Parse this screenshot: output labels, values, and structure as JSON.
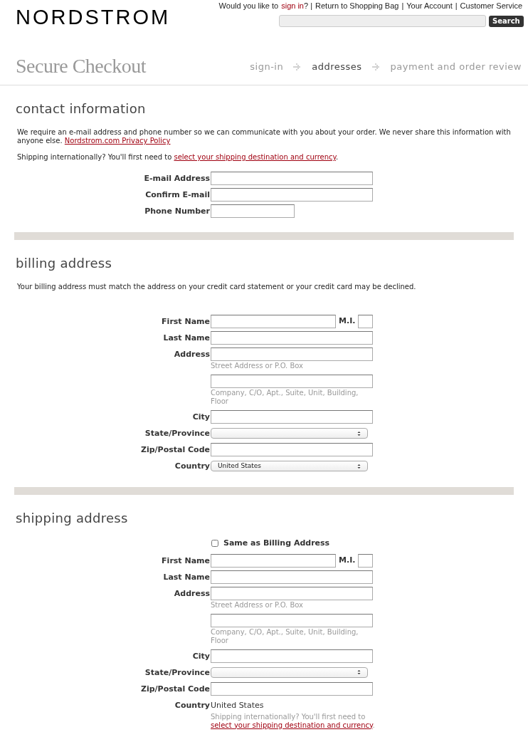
{
  "top_links": [
    {
      "kind": "text",
      "text": "Would you like to"
    },
    {
      "kind": "link",
      "text": "sign in"
    },
    {
      "kind": "text",
      "text": "? |"
    },
    {
      "kind": "text",
      "text": "Return to Shopping Bag"
    },
    {
      "kind": "text",
      "text": "|"
    },
    {
      "kind": "text",
      "text": "Your Account"
    },
    {
      "kind": "text",
      "text": "|"
    },
    {
      "kind": "text",
      "text": "Customer Service"
    }
  ],
  "logo": "NORDSTROM",
  "search": {
    "button": "Search"
  },
  "page_title": "Secure Checkout",
  "steps": [
    {
      "label": "sign-in",
      "selected": false
    },
    {
      "label": "addresses",
      "selected": true
    },
    {
      "label": "payment and order review",
      "selected": false
    }
  ],
  "sections": [
    {
      "heading": "contact information",
      "paragraphs": [
        {
          "text": "We require an e-mail address and phone number so we can communicate with you about your order. We never share this information with anyone else.",
          "link": "Nordstrom.com Privacy Policy"
        },
        {
          "text": "Shipping internationally? You'll first need to",
          "link": "select your shipping destination and currency",
          "after": "."
        }
      ],
      "fields": [
        {
          "kind": "text",
          "label": "E-mail Address"
        },
        {
          "kind": "text",
          "label": "Confirm E-mail"
        },
        {
          "kind": "short",
          "label": "Phone Number"
        }
      ]
    },
    {
      "heading": "billing address",
      "paragraphs": [
        {
          "text": "Your billing address must match the address on your credit card statement or your credit card may be declined."
        }
      ],
      "fields": [
        {
          "kind": "name",
          "label": "First Name",
          "mi_label": "M.I."
        },
        {
          "kind": "text",
          "label": "Last Name"
        },
        {
          "kind": "text",
          "label": "Address",
          "hint": "Street Address or P.O. Box"
        },
        {
          "kind": "text",
          "hint": "Company, C/O, Apt., Suite, Unit, Building, Floor"
        },
        {
          "kind": "text",
          "label": "City"
        },
        {
          "kind": "select",
          "label": "State/Province"
        },
        {
          "kind": "text",
          "label": "Zip/Postal Code"
        },
        {
          "kind": "select",
          "label": "Country",
          "value": "United States"
        }
      ]
    },
    {
      "heading": "shipping address",
      "same_as_billing": {
        "label": "Same as Billing Address",
        "checked": false
      },
      "fields": [
        {
          "kind": "name",
          "label": "First Name",
          "mi_label": "M.I."
        },
        {
          "kind": "text",
          "label": "Last Name"
        },
        {
          "kind": "text",
          "label": "Address",
          "hint": "Street Address or P.O. Box"
        },
        {
          "kind": "text",
          "hint": "Company, C/O, Apt., Suite, Unit, Building, Floor"
        },
        {
          "kind": "text",
          "label": "City"
        },
        {
          "kind": "select",
          "label": "State/Province"
        },
        {
          "kind": "text",
          "label": "Zip/Postal Code"
        },
        {
          "kind": "static",
          "label": "Country",
          "value": "United States",
          "note": "Shipping internationally? You'll first need to",
          "link": "select your shipping destination and currency",
          "after": "."
        }
      ]
    }
  ]
}
